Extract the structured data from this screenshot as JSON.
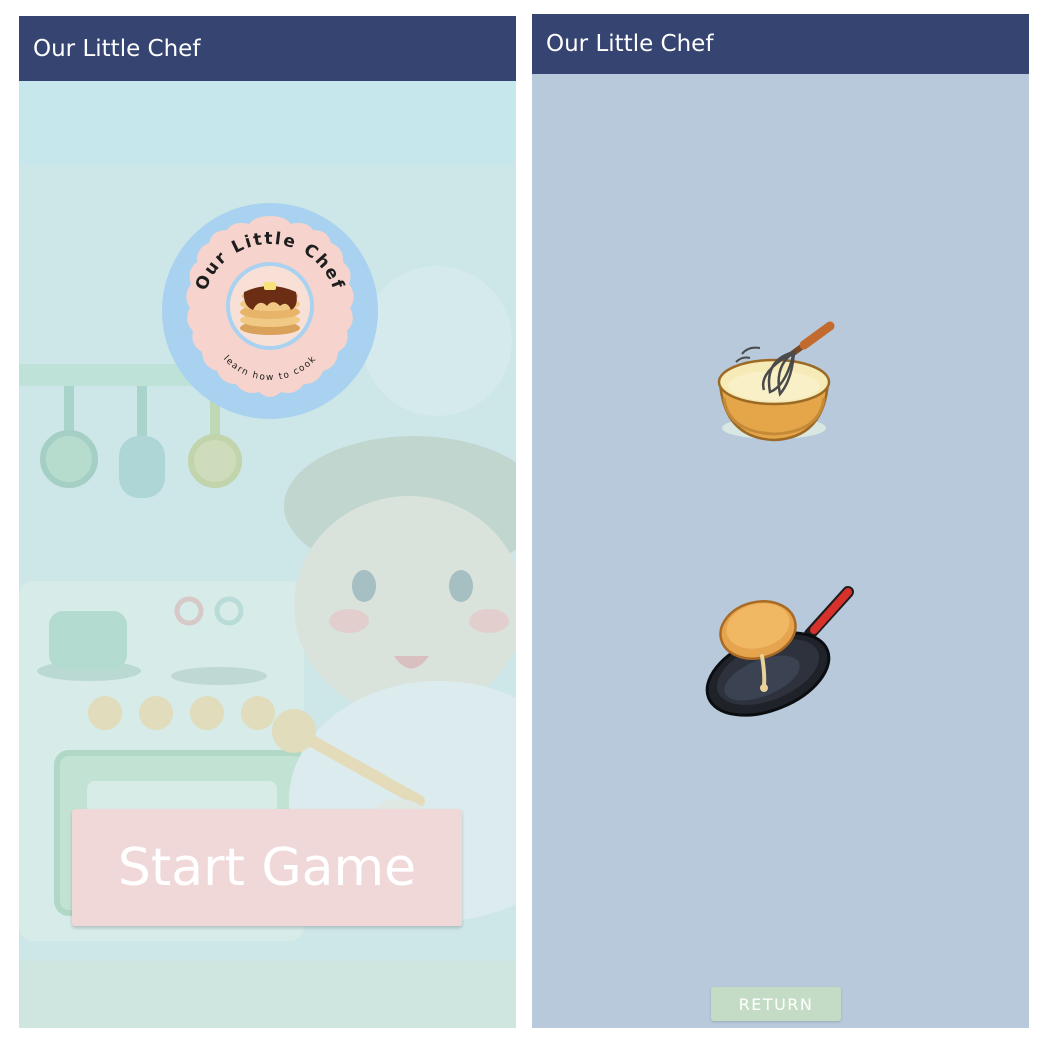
{
  "left_screen": {
    "app_title": "Our Little Chef",
    "logo": {
      "arc_text": "Our Little Chef",
      "tagline": "learn how to cook"
    },
    "start_button_label": "Start Game"
  },
  "right_screen": {
    "app_title": "Our Little Chef",
    "items": [
      {
        "name": "whisk-bowl-icon"
      },
      {
        "name": "frying-pan-icon"
      }
    ],
    "return_button_label": "RETURN"
  },
  "colors": {
    "appbar": "#354471",
    "left_background": "#c9e6ea",
    "right_background": "#b7c9da",
    "start_button": "#f0d8d9",
    "return_button": "#c4dcc6",
    "logo_ring": "#a9d2f0",
    "logo_center": "#f6d3cc"
  }
}
